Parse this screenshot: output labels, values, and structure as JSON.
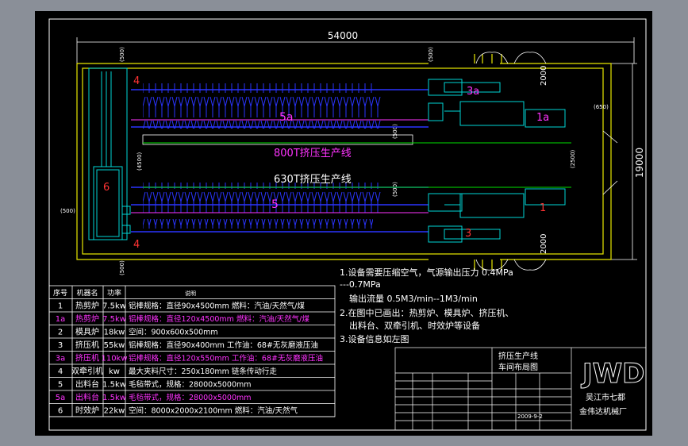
{
  "colors": {
    "outer_bg": "#8a8f98",
    "sheet": "#000000",
    "frame": "#ffffff",
    "yellow": "#e8e800",
    "green": "#00e000",
    "cyan": "#00d6d6",
    "blue": "#2a34ff",
    "magenta": "#ff33ff",
    "red": "#ff3333"
  },
  "drawing": {
    "overall_width_dim": "54000",
    "overall_height_dim": "19000",
    "dim_2000_top": "2000",
    "dim_2000_bottom": "2000",
    "dim_500_tl": "(500)",
    "dim_500_bl": "(500)",
    "dim_500_left": "(500)",
    "dim_500_top_mid": "(500)",
    "dim_650": "(650)",
    "dim_4500": "(4500)",
    "dim_2500": "(2500)",
    "dim_500_right_top": "(500)",
    "dim_500_right_bottom": "(500)",
    "mark_4_top": "4",
    "mark_4_bottom": "4",
    "mark_6": "6",
    "mark_5a": "5a",
    "mark_5": "5",
    "mark_3a": "3a",
    "mark_3": "3",
    "mark_1a": "1a",
    "mark_1": "1",
    "line_top_label": "800T挤压生产线",
    "line_bottom_label": "630T挤压生产线"
  },
  "notes": {
    "line1": "1.设备需要压缩空气，气源输出压力  0.4MPa",
    "line2": "---0.7MPa",
    "line3": "输出流量  0.5M3/min--1M3/min",
    "line4": "2.在图中已画出：热剪炉、模具炉、挤压机、",
    "line5": "出料台、双牵引机、时效炉等设备",
    "line6": "3.设备信息如左图"
  },
  "table": {
    "headers": [
      "序号",
      "机器名",
      "功率",
      "说明"
    ],
    "rows": [
      {
        "no": "1",
        "name": "热剪炉",
        "power": "7.5kw",
        "desc": "铝棒规格：直径90x4500mm    燃料：汽油/天然气/煤",
        "pink": false
      },
      {
        "no": "1a",
        "name": "热剪炉",
        "power": "7.5kw",
        "desc": "铝棒规格：直径120x4500mm    燃料：汽油/天然气/煤",
        "pink": true
      },
      {
        "no": "2",
        "name": "模具炉",
        "power": "18kw",
        "desc": "空间：900x600x500mm",
        "pink": false
      },
      {
        "no": "3",
        "name": "挤压机",
        "power": "55kw",
        "desc": "铝棒规格：直径90x400mm    工作油：68#无灰磨液压油",
        "pink": false
      },
      {
        "no": "3a",
        "name": "挤压机",
        "power": "110kw",
        "desc": "铝棒规格：直径120x550mm    工作油：68#无灰磨液压油",
        "pink": true
      },
      {
        "no": "4",
        "name": "双牵引机",
        "power": "kw",
        "desc": "最大夹料尺寸：250x180mm    链条传动行走",
        "pink": false
      },
      {
        "no": "5",
        "name": "出料台",
        "power": "1.5kw",
        "desc": "毛毡带式，规格：28000x5000mm",
        "pink": false
      },
      {
        "no": "5a",
        "name": "出料台",
        "power": "1.5kw",
        "desc": "毛毡带式，规格：28000x5000mm",
        "pink": true
      },
      {
        "no": "6",
        "name": "时效炉",
        "power": "22kw",
        "desc": "空间：8000x2000x2100mm    燃料：汽油/天然气",
        "pink": false
      }
    ]
  },
  "title_block": {
    "title_line1": "挤压生产线",
    "title_line2": "车间布局图",
    "company_line1": "吴江市七都",
    "company_line2": "金伟达机械厂",
    "logo_text": "JWD",
    "date": "2009-9-2"
  }
}
